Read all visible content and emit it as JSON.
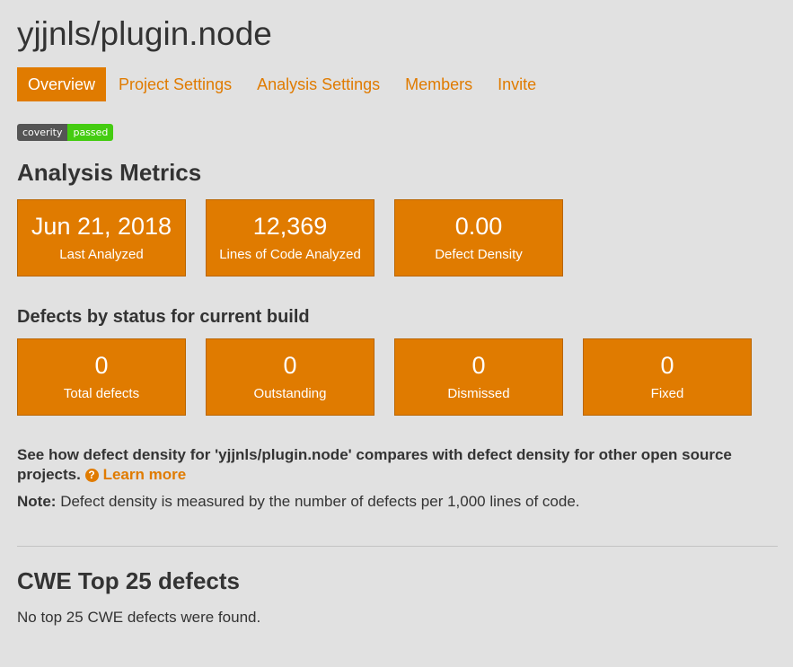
{
  "project": {
    "title": "yjjnls/plugin.node"
  },
  "tabs": [
    {
      "label": "Overview",
      "active": true
    },
    {
      "label": "Project Settings",
      "active": false
    },
    {
      "label": "Analysis Settings",
      "active": false
    },
    {
      "label": "Members",
      "active": false
    },
    {
      "label": "Invite",
      "active": false
    }
  ],
  "badge": {
    "left": "coverity",
    "right": "passed",
    "left_color": "#555555",
    "right_color": "#44cc11"
  },
  "metrics": {
    "heading": "Analysis Metrics",
    "tiles": [
      {
        "value": "Jun 21, 2018",
        "label": "Last Analyzed"
      },
      {
        "value": "12,369",
        "label": "Lines of Code Analyzed"
      },
      {
        "value": "0.00",
        "label": "Defect Density"
      }
    ]
  },
  "defects": {
    "heading": "Defects by status for current build",
    "tiles": [
      {
        "value": "0",
        "label": "Total defects"
      },
      {
        "value": "0",
        "label": "Outstanding"
      },
      {
        "value": "0",
        "label": "Dismissed"
      },
      {
        "value": "0",
        "label": "Fixed"
      }
    ]
  },
  "compare": {
    "text": "See how defect density for 'yjjnls/plugin.node' compares with defect density for other open source projects.",
    "icon": "question-circle-icon",
    "learn_more": "Learn more"
  },
  "note": {
    "label": "Note:",
    "text": "Defect density is measured by the number of defects per 1,000 lines of code."
  },
  "cwe": {
    "heading": "CWE Top 25 defects",
    "text": "No top 25 CWE defects were found."
  },
  "colors": {
    "accent": "#e07b00",
    "background": "#e1e1e1",
    "text": "#333333"
  }
}
